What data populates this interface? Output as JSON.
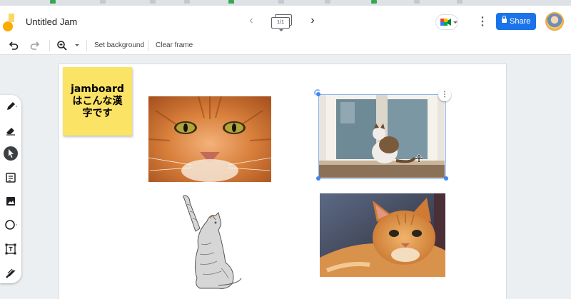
{
  "app": {
    "title": "Untitled Jam",
    "frame_indicator": "1/1"
  },
  "header": {
    "share_label": "Share"
  },
  "toolbar": {
    "set_background_label": "Set background",
    "clear_frame_label": "Clear frame"
  },
  "sticky_note": {
    "text": "jamboard\nはこんな漢\n字です",
    "color": "#fbe366"
  },
  "colors": {
    "accent": "#1a73e8",
    "selection": "#8ab4f8",
    "canvas_bg": "#eceff1"
  },
  "icons": {
    "undo": "undo-icon",
    "redo": "redo-icon",
    "zoom": "zoom-in-icon",
    "pen": "pen-icon",
    "eraser": "eraser-icon",
    "select": "select-arrow-icon",
    "sticky": "sticky-note-icon",
    "image": "image-icon",
    "shape": "circle-shape-icon",
    "textbox": "text-box-icon",
    "laser": "laser-icon"
  }
}
